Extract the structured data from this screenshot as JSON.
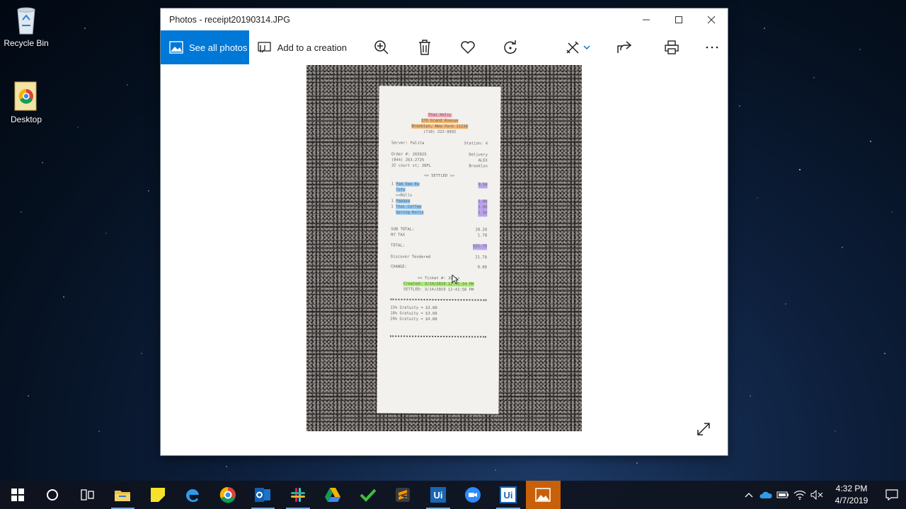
{
  "desktop": {
    "icons": [
      {
        "label": "Recycle Bin",
        "icon": "recycle-bin-icon"
      },
      {
        "label": "Desktop",
        "icon": "chrome-shortcut-icon"
      }
    ]
  },
  "window": {
    "title": "Photos - receipt20190314.JPG",
    "controls": [
      "minimize",
      "maximize",
      "close"
    ]
  },
  "toolbar": {
    "see_all_label": "See all photos",
    "add_creation_label": "Add to a creation",
    "icons": [
      "zoom-in-icon",
      "delete-icon",
      "favorite-icon",
      "rotate-icon",
      "edit-icon",
      "share-icon",
      "print-icon",
      "more-icon"
    ]
  },
  "receipt": {
    "restaurant": "Thai Holic",
    "address_line": "370 Grand Avenue",
    "city_line": "Brooklyn, New York 11238",
    "phone": "(718) 222-9992",
    "server": "Server: Palita",
    "station": "Station: 4",
    "order": "Order #: 265025",
    "order_type": "Delivery",
    "customer_phone": "(844) 263-2725",
    "customer_name": "ALEX",
    "customer_addr": "32 court st; 20FL",
    "customer_city": "Brooklyn",
    "settled": "<< SETTLED >>",
    "items": [
      {
        "qty": "1",
        "name": "Pad See Ew",
        "price": "9.50"
      },
      {
        "qty": "",
        "name": "Tofu",
        "price": ""
      },
      {
        "qty": "",
        "name": "<<Rolls",
        "price": ""
      },
      {
        "qty": "1",
        "name": "Papaya",
        "price": "5.00"
      },
      {
        "qty": "1",
        "name": "Thai Coffee",
        "price": "3.00"
      },
      {
        "qty": "",
        "name": "Spring Rolls",
        "price": "2.50"
      }
    ],
    "subtotal_label": "SUB TOTAL:",
    "subtotal": "20.20",
    "tax_label": "NY TAX",
    "tax": "1.78",
    "total_label": "TOTAL:",
    "total": "$21.78",
    "tender_label": "Discover Tendered",
    "tender": "21.78",
    "change_label": "CHANGE:",
    "change": "0.00",
    "ticket": "<< Ticket #: 39 >>",
    "created": "Created: 3/14/2019 12:41:34 PM",
    "settled_at": "SETTLED: 3/14/2019 12:41:50 PM",
    "gratuity": [
      "15% Gratuity = $3.00",
      "18% Gratuity = $3.60",
      "20% Gratuity = $4.00"
    ]
  },
  "taskbar": {
    "apps": [
      "windows-start-icon",
      "cortana-icon",
      "task-view-icon",
      "file-explorer-icon",
      "sticky-notes-icon",
      "edge-icon",
      "chrome-icon",
      "outlook-icon",
      "slack-icon",
      "google-drive-icon",
      "checkmark-app-icon",
      "sublime-icon",
      "uipath-studio-icon",
      "zoom-icon",
      "uipath-robot-icon",
      "photos-icon"
    ],
    "time": "4:32 PM",
    "date": "4/7/2019"
  },
  "colors": {
    "accent": "#0078d7",
    "active_task": "#c8600a"
  }
}
